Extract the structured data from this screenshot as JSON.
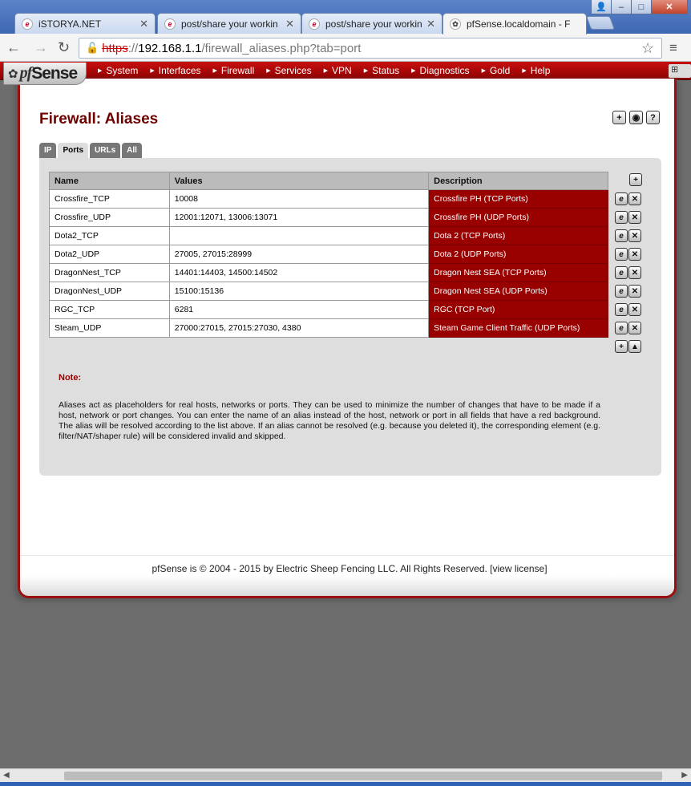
{
  "browser": {
    "tabs": [
      {
        "title": "iSTORYA.NET",
        "icon": "istorya-favicon"
      },
      {
        "title": "post/share your workin",
        "icon": "istorya-favicon"
      },
      {
        "title": "post/share your workin",
        "icon": "istorya-favicon"
      },
      {
        "title": "pfSense.localdomain - F",
        "icon": "pfsense-favicon",
        "active": true
      }
    ],
    "url": {
      "scheme": "https",
      "sep": "://",
      "host": "192.168.1.1",
      "path": "/firewall_aliases.php?tab=port"
    },
    "window_buttons": {
      "user": "👤",
      "minimize": "–",
      "maximize": "□",
      "close": "✕"
    }
  },
  "nav": {
    "logo": {
      "pf": "pf",
      "sense": "Sense"
    },
    "items": [
      "System",
      "Interfaces",
      "Firewall",
      "Services",
      "VPN",
      "Status",
      "Diagnostics",
      "Gold",
      "Help"
    ]
  },
  "page": {
    "title": "Firewall: Aliases",
    "tabs": [
      {
        "label": "IP",
        "active": false
      },
      {
        "label": "Ports",
        "active": true
      },
      {
        "label": "URLs",
        "active": false
      },
      {
        "label": "All",
        "active": false
      }
    ]
  },
  "table": {
    "headers": [
      "Name",
      "Values",
      "Description"
    ],
    "rows": [
      {
        "name": "Crossfire_TCP",
        "values": "10008",
        "description": "Crossfire PH (TCP Ports)"
      },
      {
        "name": "Crossfire_UDP",
        "values": "12001:12071, 13006:13071",
        "description": "Crossfire PH (UDP Ports)"
      },
      {
        "name": "Dota2_TCP",
        "values": "",
        "description": "Dota 2 (TCP Ports)"
      },
      {
        "name": "Dota2_UDP",
        "values": "27005, 27015:28999",
        "description": "Dota 2 (UDP Ports)"
      },
      {
        "name": "DragonNest_TCP",
        "values": "14401:14403, 14500:14502",
        "description": "Dragon Nest SEA (TCP Ports)"
      },
      {
        "name": "DragonNest_UDP",
        "values": "15100:15136",
        "description": "Dragon Nest SEA (UDP Ports)"
      },
      {
        "name": "RGC_TCP",
        "values": "6281",
        "description": "RGC (TCP Port)"
      },
      {
        "name": "Steam_UDP",
        "values": "27000:27015, 27015:27030, 4380",
        "description": "Steam Game Client Traffic (UDP Ports)"
      }
    ]
  },
  "note": {
    "label": "Note:",
    "text": "Aliases act as placeholders for real hosts, networks or ports. They can be used to minimize the number of changes that have to be made if a host, network or port changes. You can enter the name of an alias instead of the host, network or port in all fields that have a red background. The alias will be resolved according to the list above. If an alias cannot be resolved (e.g. because you deleted it), the corresponding element (e.g. filter/NAT/shaper rule) will be considered invalid and skipped."
  },
  "footer": {
    "text": "pfSense is © 2004 - 2015 by Electric Sheep Fencing LLC. All Rights Reserved. [",
    "link": "view license",
    "end": "]"
  }
}
